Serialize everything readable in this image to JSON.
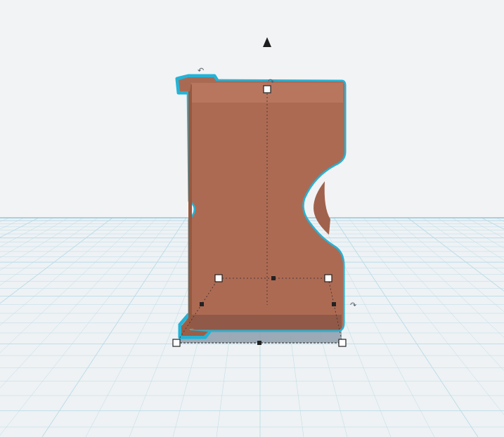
{
  "app": {
    "view": "3d-workplane-viewport",
    "theme": {
      "background": "#f2f3f5",
      "grid_line": "#b9dbe8",
      "grid_horizon": "#8fc6dc",
      "object_fill": "#ad6a53",
      "object_top_band": "#b97860",
      "object_bottom_band": "#8e5846",
      "selection_outline": "#24b3d6",
      "shadow": "#8c9eaa",
      "handle_fill": "#ffffff",
      "handle_stroke": "#222222"
    }
  },
  "scene": {
    "selected_object": {
      "name": "selected-shape",
      "selected": true
    },
    "handles": {
      "lift_arrow_icon": "up-triangle-icon",
      "rotate_icons": [
        "rotate-arrow-icon",
        "rotate-arrow-icon",
        "rotate-arrow-icon"
      ],
      "rotate_glyphs": [
        "↶",
        "↷",
        "↷"
      ]
    }
  }
}
